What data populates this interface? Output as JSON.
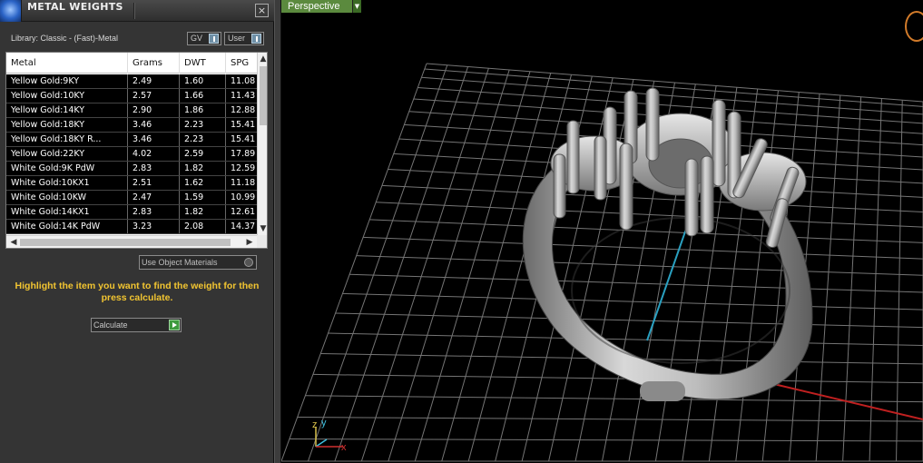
{
  "panel": {
    "title": "METAL WEIGHTS",
    "close_glyph": "×",
    "library_label": "Library: Classic - (Fast)-Metal",
    "toggles": {
      "gv": "GV",
      "user": "User"
    },
    "table": {
      "columns": [
        "Metal",
        "Grams",
        "DWT",
        "SPG"
      ],
      "rows": [
        [
          "Yellow Gold:9KY",
          "2.49",
          "1.60",
          "11.08"
        ],
        [
          "Yellow Gold:10KY",
          "2.57",
          "1.66",
          "11.43"
        ],
        [
          "Yellow Gold:14KY",
          "2.90",
          "1.86",
          "12.88"
        ],
        [
          "Yellow Gold:18KY",
          "3.46",
          "2.23",
          "15.41"
        ],
        [
          "Yellow Gold:18KY R...",
          "3.46",
          "2.23",
          "15.41"
        ],
        [
          "Yellow Gold:22KY",
          "4.02",
          "2.59",
          "17.89"
        ],
        [
          "White Gold:9K PdW",
          "2.83",
          "1.82",
          "12.59"
        ],
        [
          "White Gold:10KX1",
          "2.51",
          "1.62",
          "11.18"
        ],
        [
          "White Gold:10KW",
          "2.47",
          "1.59",
          "10.99"
        ],
        [
          "White Gold:14KX1",
          "2.83",
          "1.82",
          "12.61"
        ],
        [
          "White Gold:14K PdW",
          "3.23",
          "2.08",
          "14.37"
        ]
      ]
    },
    "use_object_materials": "Use Object Materials",
    "hint": "Highlight the item you want to find the weight for then press calculate.",
    "calculate_label": "Calculate",
    "icons": {
      "app": "rhino-app-icon",
      "close": "close-icon",
      "scroll_up": "chevron-up-icon",
      "scroll_down": "chevron-down-icon",
      "scroll_left": "chevron-left-icon",
      "scroll_right": "chevron-right-icon",
      "calculate": "play-arrow-icon"
    }
  },
  "viewport": {
    "label": "Perspective",
    "dropdown_glyph": "▼",
    "axis_labels": {
      "x": "x",
      "y": "y",
      "z": "z"
    },
    "colors": {
      "background": "#000000",
      "grid": "#8a8a8a",
      "x_axis": "#c02020",
      "y_axis": "#2aa0c0",
      "label_bg": "#5b8a3e",
      "hint_text": "#f2c531"
    },
    "model": "three-stone-ring"
  }
}
